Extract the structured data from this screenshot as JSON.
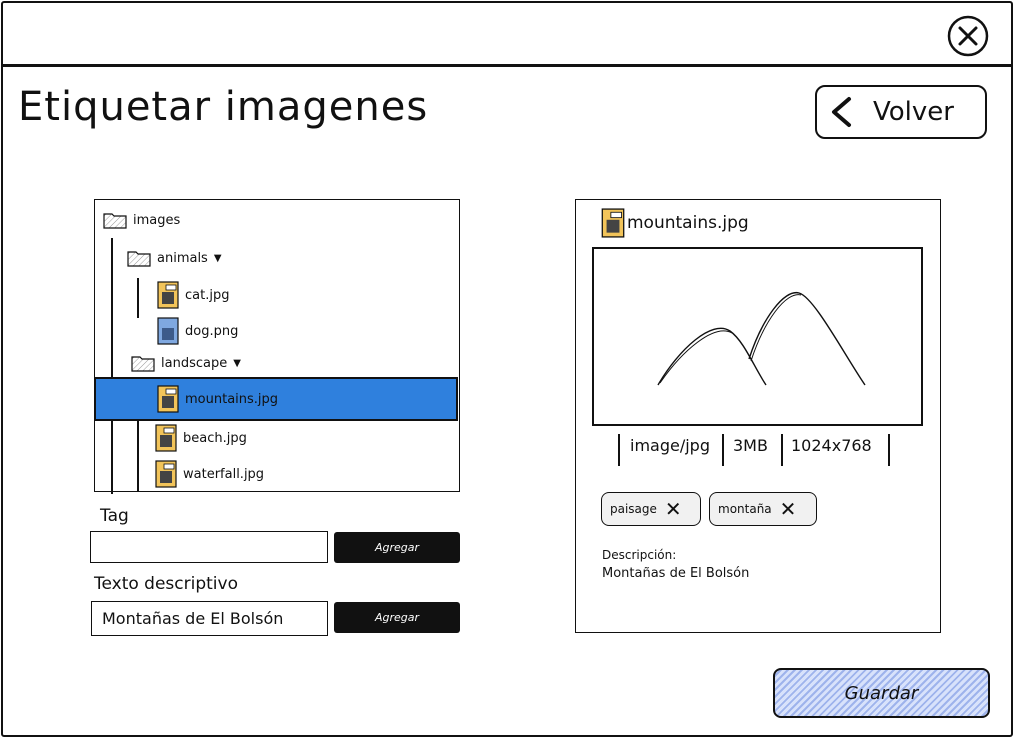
{
  "window": {
    "title": "Etiquetar imagenes",
    "back_label": "Volver",
    "icons": {
      "close": "close-circle-icon",
      "back": "chevron-left-icon"
    }
  },
  "tree": {
    "root": "images",
    "items": [
      {
        "label": "images",
        "type": "folder"
      },
      {
        "label": "animals",
        "type": "folder",
        "expanded": true
      },
      {
        "label": "cat.jpg",
        "type": "image-file"
      },
      {
        "label": "dog.png",
        "type": "image-file"
      },
      {
        "label": "landscape",
        "type": "folder",
        "expanded": true
      },
      {
        "label": "mountains.jpg",
        "type": "image-file",
        "selected": true
      },
      {
        "label": "beach.jpg",
        "type": "image-file"
      },
      {
        "label": "waterfall.jpg",
        "type": "image-file"
      }
    ],
    "expand_glyph": "▼"
  },
  "tag": {
    "label": "Tag",
    "value": "",
    "button": "Agregar"
  },
  "description_field": {
    "label": "Texto descriptivo",
    "value": "Montañas de El Bolsón",
    "button": "Agregar"
  },
  "preview": {
    "filename": "mountains.jpg",
    "mime": "image/jpg",
    "size": "3MB",
    "dimensions": "1024x768",
    "tags": [
      {
        "label": "paisage"
      },
      {
        "label": "montaña"
      }
    ],
    "description_label": "Descripción:",
    "description_value": "Montañas de El Bolsón"
  },
  "footer": {
    "save_label": "Guardar"
  },
  "colors": {
    "selection": "#2f80dd",
    "save_button": "#b9c8f3",
    "ink": "#111111"
  }
}
